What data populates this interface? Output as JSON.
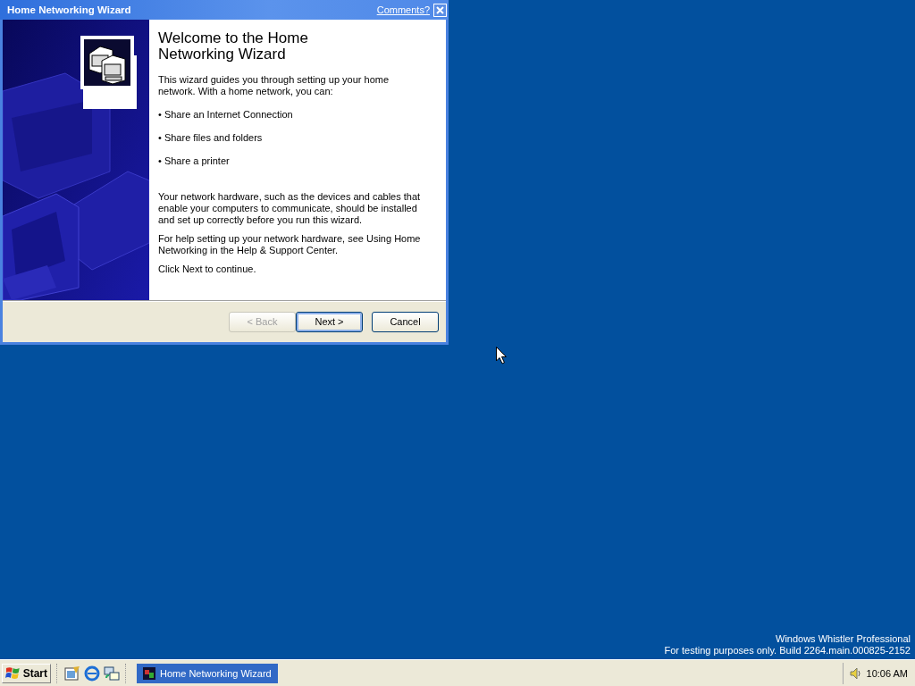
{
  "window": {
    "title": "Home Networking Wizard",
    "comments_link": "Comments?"
  },
  "wizard": {
    "heading": "Welcome to the Home Networking Wizard",
    "intro": "This wizard guides you through setting up your home network. With a home network, you can:",
    "bullets": [
      "• Share an Internet Connection",
      "• Share files and folders",
      "• Share a printer"
    ],
    "paragraphs": [
      "Your network hardware, such as the devices and cables that enable your computers to communicate, should be installed and set up correctly before you run this wizard.",
      "For help setting up your network hardware, see Using Home Networking in the Help & Support Center.",
      "Click Next to continue."
    ],
    "buttons": [
      {
        "label": "< Back",
        "disabled": true,
        "default": false
      },
      {
        "label": "Next >",
        "disabled": false,
        "default": true
      },
      {
        "label": "Cancel",
        "disabled": false,
        "default": false
      }
    ]
  },
  "desktop": {
    "build_info": [
      "Windows Whistler Professional",
      "For testing purposes only. Build 2264.main.000825-2152"
    ]
  },
  "taskbar": {
    "start": "Start",
    "tasks": [
      {
        "label": "Home Networking Wizard",
        "selected": true
      }
    ],
    "clock": "10:06 AM"
  }
}
